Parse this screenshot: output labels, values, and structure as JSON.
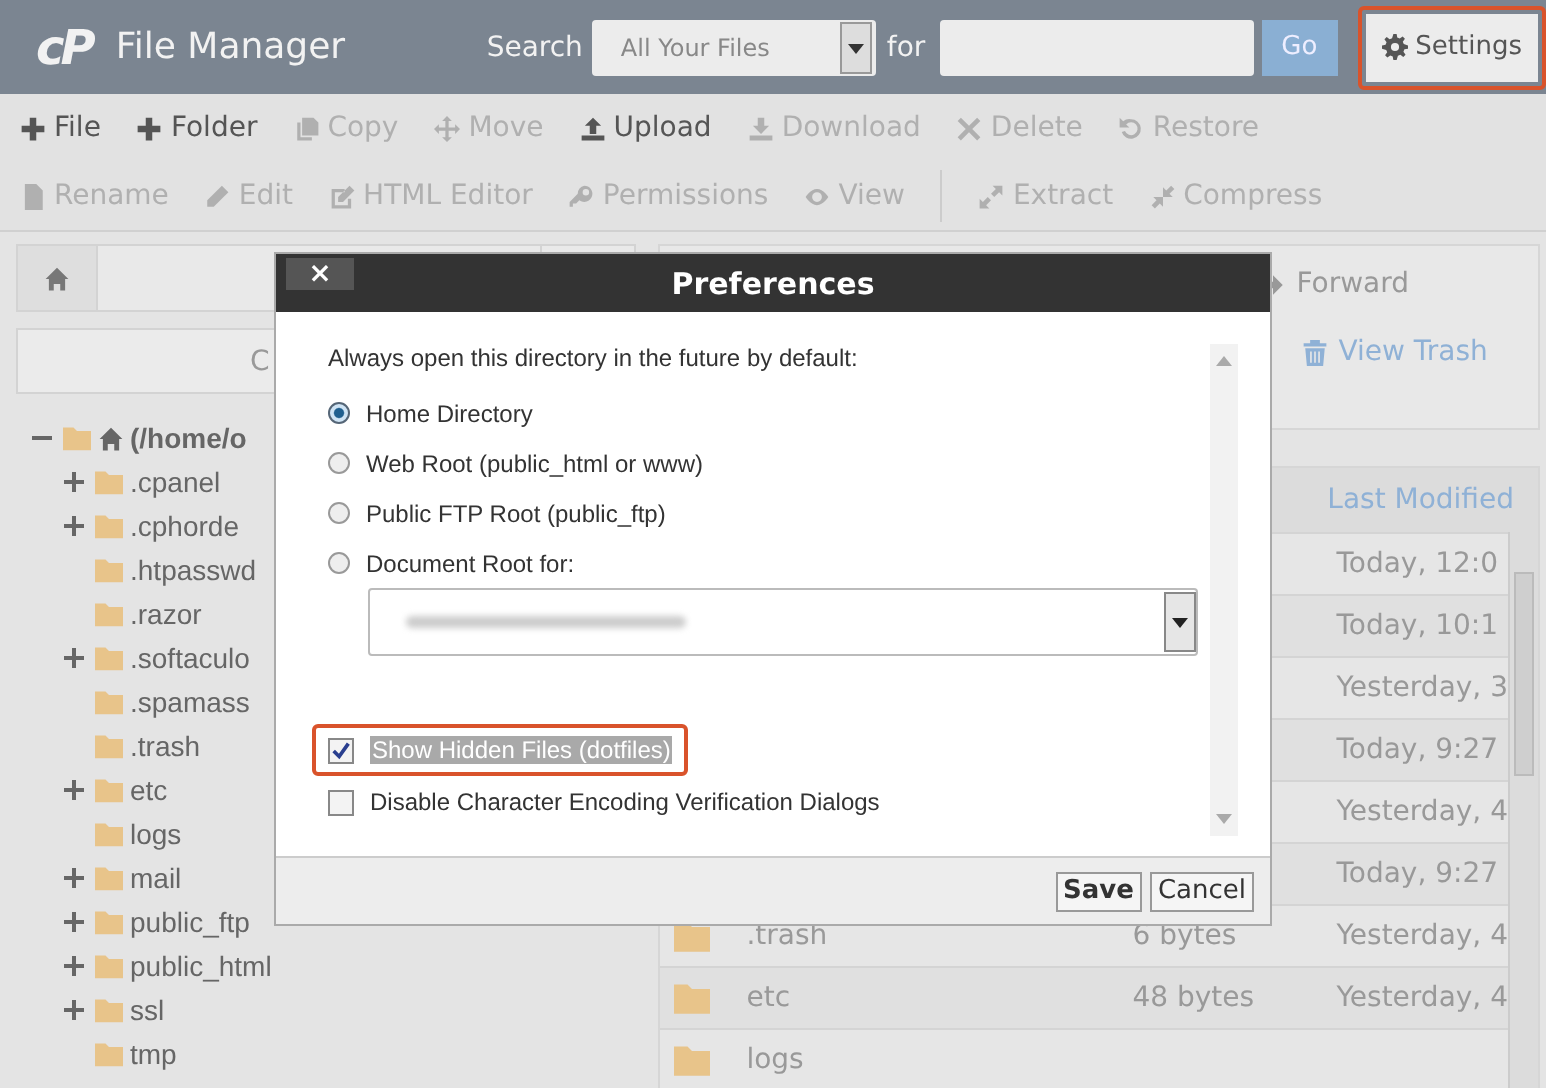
{
  "header": {
    "logo": "cP",
    "title": "File Manager",
    "search_label": "Search",
    "search_scope": "All Your Files",
    "for_label": "for",
    "go": "Go",
    "settings": {
      "label": "Settings",
      "highlighted": true
    }
  },
  "toolbar": [
    [
      {
        "label": "File",
        "disabled": false
      },
      {
        "label": "Folder",
        "disabled": false
      },
      {
        "label": "Copy",
        "disabled": true
      },
      {
        "label": "Move",
        "disabled": true
      },
      {
        "label": "Upload",
        "disabled": false
      },
      {
        "label": "Download",
        "disabled": true
      },
      {
        "label": "Delete",
        "disabled": true
      },
      {
        "label": "Restore",
        "disabled": true
      }
    ],
    [
      {
        "label": "Rename",
        "disabled": true
      },
      {
        "label": "Edit",
        "disabled": true
      },
      {
        "label": "HTML Editor",
        "disabled": true
      },
      {
        "label": "Permissions",
        "disabled": true
      },
      {
        "label": "View",
        "disabled": true
      },
      {
        "label": "Extract",
        "disabled": true
      },
      {
        "label": "Compress",
        "disabled": true
      }
    ]
  ],
  "sidebar": {
    "collapse_button": "C",
    "tree": {
      "label": "(/home/o",
      "expanded": true,
      "children": [
        {
          "label": ".cpanel",
          "expandable": true
        },
        {
          "label": ".cphorde",
          "expandable": true
        },
        {
          "label": ".htpasswd",
          "expandable": false
        },
        {
          "label": ".razor",
          "expandable": false
        },
        {
          "label": ".softaculo",
          "expandable": true
        },
        {
          "label": ".spamass",
          "expandable": false
        },
        {
          "label": ".trash",
          "expandable": false
        },
        {
          "label": "etc",
          "expandable": true
        },
        {
          "label": "logs",
          "expandable": false
        },
        {
          "label": "mail",
          "expandable": true
        },
        {
          "label": "public_ftp",
          "expandable": true
        },
        {
          "label": "public_html",
          "expandable": true
        },
        {
          "label": "ssl",
          "expandable": true
        },
        {
          "label": "tmp",
          "expandable": false
        }
      ]
    }
  },
  "nav": {
    "forward": "Forward",
    "view_trash": "View Trash"
  },
  "table": {
    "columns": [
      {
        "label": "Last Modified"
      }
    ],
    "rows": [
      {
        "modified": "Today, 12:0"
      },
      {
        "modified": "Today, 10:1"
      },
      {
        "modified": "Yesterday, 3"
      },
      {
        "modified": "Today, 9:27"
      },
      {
        "modified": "Yesterday, 4"
      },
      {
        "modified": "Today, 9:27"
      },
      {
        "name": ".trash",
        "size": "6 bytes",
        "modified": "Yesterday, 4"
      },
      {
        "name": "etc",
        "size": "48 bytes",
        "modified": "Yesterday, 4"
      },
      {
        "name": "logs",
        "modified": ""
      }
    ]
  },
  "dialog": {
    "title": "Preferences",
    "close": "×",
    "intro": "Always open this directory in the future by default:",
    "options": [
      {
        "label": "Home Directory",
        "selected": true
      },
      {
        "label": "Web Root (public_html or www)",
        "selected": false
      },
      {
        "label": "Public FTP Root (public_ftp)",
        "selected": false
      },
      {
        "label": "Document Root for:",
        "selected": false
      }
    ],
    "checkboxes": [
      {
        "label": "Show Hidden Files (dotfiles)",
        "checked": true,
        "highlighted": true
      },
      {
        "label": "Disable Character Encoding Verification Dialogs",
        "checked": false,
        "highlighted": false
      }
    ],
    "buttons": [
      {
        "label": "Save",
        "kind": "primary"
      },
      {
        "label": "Cancel",
        "kind": "secondary"
      }
    ]
  }
}
